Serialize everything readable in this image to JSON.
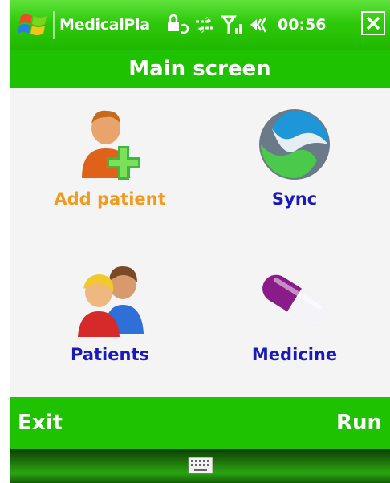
{
  "statusbar": {
    "app_title": "MedicalPla",
    "clock": "00:56",
    "start_icon": "windows-flag-icon",
    "icons": [
      "lock-sync-icon",
      "connectivity-arrows-icon",
      "signal-icon",
      "volume-icon",
      "close-icon"
    ]
  },
  "titlebar": {
    "title": "Main screen"
  },
  "tiles": {
    "add_patient": {
      "label": "Add patient",
      "icon": "add-patient-icon",
      "color": "#f39a1c"
    },
    "sync": {
      "label": "Sync",
      "icon": "sync-icon",
      "color": "#1a1ab9"
    },
    "patients": {
      "label": "Patients",
      "icon": "patients-icon",
      "color": "#1a1ab9"
    },
    "medicine": {
      "label": "Medicine",
      "icon": "pill-icon",
      "color": "#1a1ab9"
    }
  },
  "softkeys": {
    "left": "Exit",
    "right": "Run"
  },
  "bottombar": {
    "icon": "keyboard-icon"
  },
  "colors": {
    "accent_green": "#1fc200",
    "label_blue": "#1a1ab9",
    "label_orange": "#f39a1c"
  }
}
